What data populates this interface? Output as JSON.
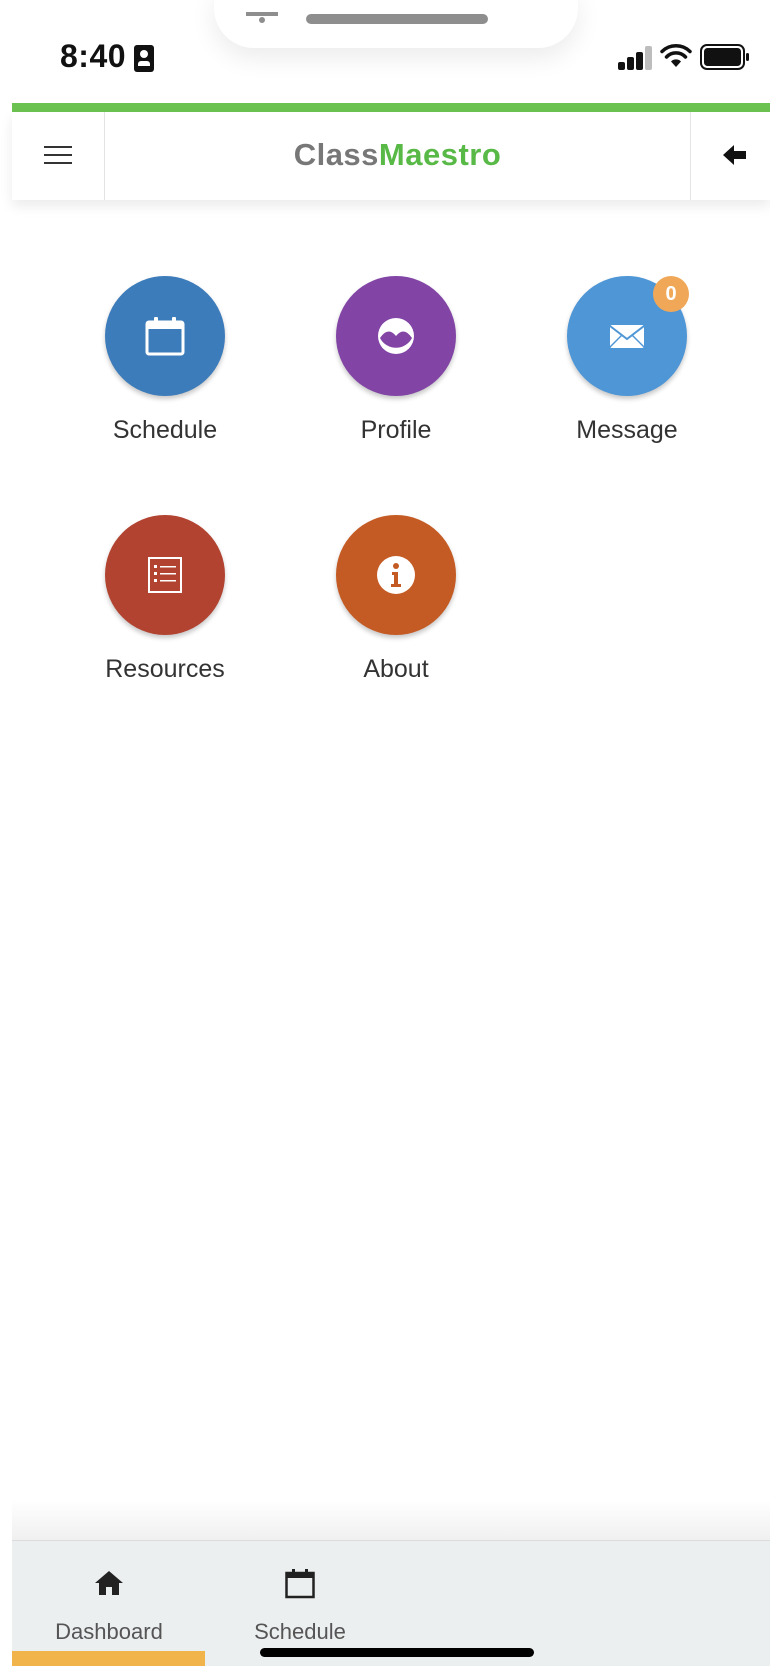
{
  "status_bar": {
    "time": "8:40"
  },
  "header": {
    "brand_part1": "Class",
    "brand_part2": "Maestro"
  },
  "tiles": [
    {
      "label": "Schedule",
      "color": "#3d7cba",
      "icon": "calendar-icon"
    },
    {
      "label": "Profile",
      "color": "#8245a6",
      "icon": "profile-icon"
    },
    {
      "label": "Message",
      "color": "#4f96d6",
      "icon": "envelope-icon",
      "badge": "0"
    },
    {
      "label": "Resources",
      "color": "#b24330",
      "icon": "list-icon"
    },
    {
      "label": "About",
      "color": "#c55b24",
      "icon": "info-icon"
    }
  ],
  "bottom_nav": [
    {
      "label": "Dashboard",
      "icon": "home-icon",
      "active": true
    },
    {
      "label": "Schedule",
      "icon": "calendar-icon"
    }
  ],
  "colors": {
    "accent_green": "#6cc251",
    "active_tab": "#f0b44a"
  }
}
